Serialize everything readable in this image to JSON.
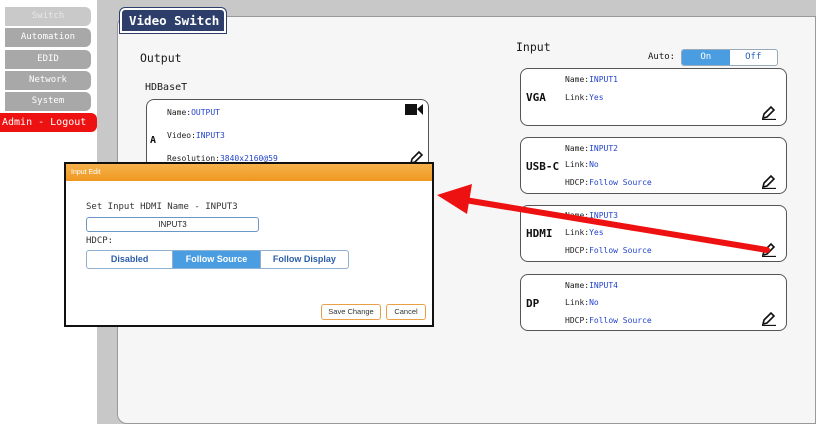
{
  "sidebar": {
    "items": [
      {
        "label": "Switch"
      },
      {
        "label": "Automation"
      },
      {
        "label": "EDID"
      },
      {
        "label": "Network"
      },
      {
        "label": "System"
      }
    ],
    "logout_label": "Admin - Logout"
  },
  "page": {
    "title": "Video Switch",
    "output_heading": "Output",
    "hdbaset_heading": "HDBaseT",
    "input_heading": "Input",
    "auto_label": "Auto:",
    "auto_on": "On",
    "auto_off": "Off"
  },
  "output": {
    "port": "A",
    "name_label": "Name:",
    "name": "OUTPUT",
    "video_label": "Video:",
    "video": "INPUT3",
    "resolution_label": "Resolution:",
    "resolution": "3840x2160@59"
  },
  "inputs": [
    {
      "port": "VGA",
      "name_label": "Name:",
      "name": "INPUT1",
      "link_label": "Link:",
      "link": "Yes"
    },
    {
      "port": "USB-C",
      "name_label": "Name:",
      "name": "INPUT2",
      "link_label": "Link:",
      "link": "No",
      "hdcp_label": "HDCP:",
      "hdcp": "Follow Source"
    },
    {
      "port": "HDMI",
      "name_label": "Name:",
      "name": "INPUT3",
      "link_label": "Link:",
      "link": "Yes",
      "hdcp_label": "HDCP:",
      "hdcp": "Follow Source"
    },
    {
      "port": "DP",
      "name_label": "Name:",
      "name": "INPUT4",
      "link_label": "Link:",
      "link": "No",
      "hdcp_label": "HDCP:",
      "hdcp": "Follow Source"
    }
  ],
  "modal": {
    "title": "Input Edit",
    "set_name_label": "Set Input HDMI Name - INPUT3",
    "name_value": "INPUT3",
    "hdcp_label": "HDCP:",
    "hdcp_options": [
      "Disabled",
      "Follow Source",
      "Follow Display"
    ],
    "hdcp_selected": "Follow Source",
    "save_label": "Save Change",
    "cancel_label": "Cancel"
  },
  "colors": {
    "title_bar": "#2d3e6b",
    "accent_blue": "#4a9de0",
    "value_blue": "#2244cc",
    "logout_red": "#ee1111",
    "modal_header_orange": "#ef9820",
    "arrow_red": "#ee1111"
  },
  "icons": [
    "camera-icon",
    "pencil-icon",
    "arrow-annotation"
  ]
}
